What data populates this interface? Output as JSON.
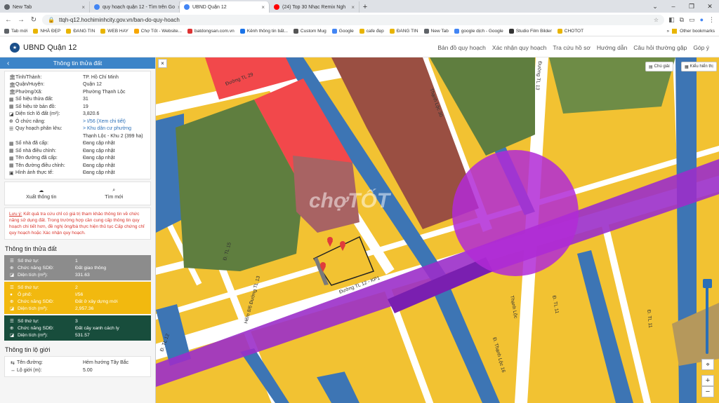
{
  "browser": {
    "tabs": [
      {
        "title": "New Tab",
        "color": "#5f6368",
        "active": false
      },
      {
        "title": "quy hoạch quận 12 - Tìm trên Go",
        "color": "#4285f4",
        "active": false
      },
      {
        "title": "UBND Quận 12",
        "color": "#4285f4",
        "active": true
      },
      {
        "title": "(24) Top 30 Nhạc Remix Ngh",
        "color": "#ff0000",
        "active": false
      }
    ],
    "url": "ttqh-q12.hochiminhcity.gov.vn/ban-do-quy-hoach",
    "bookmarks": [
      {
        "label": "Tab mới",
        "color": "#5f6368"
      },
      {
        "label": "NHÀ ĐẸP",
        "color": "#e8b400"
      },
      {
        "label": "ĐANG TIN",
        "color": "#e8b400"
      },
      {
        "label": "WEB HAY",
        "color": "#e8b400"
      },
      {
        "label": "Chợ Tốt - Website...",
        "color": "#f7a600"
      },
      {
        "label": "batdongsan.com.vn",
        "color": "#d33"
      },
      {
        "label": "Kênh thông tin bất...",
        "color": "#1a73e8"
      },
      {
        "label": "Custom Mug",
        "color": "#555"
      },
      {
        "label": "Google",
        "color": "#4285f4"
      },
      {
        "label": "cafe đẹp",
        "color": "#e8b400"
      },
      {
        "label": "ĐANG TIN",
        "color": "#e8b400"
      },
      {
        "label": "New Tab",
        "color": "#5f6368"
      },
      {
        "label": "google dịch - Google",
        "color": "#4285f4"
      },
      {
        "label": "Studio Film Bilder",
        "color": "#333"
      },
      {
        "label": "CHOTOT",
        "color": "#e8b400"
      }
    ],
    "other_bookmarks": "Other bookmarks"
  },
  "site": {
    "title": "UBND Quận 12",
    "nav": [
      "Bản đồ quy hoạch",
      "Xác nhận quy hoạch",
      "Tra cứu hồ sơ",
      "Hướng dẫn",
      "Câu hỏi thường gặp",
      "Góp ý"
    ]
  },
  "sidebar": {
    "header": "Thông tin thửa đất",
    "info": [
      {
        "label": "Tỉnh/Thành:",
        "value": "TP. Hồ Chí Minh"
      },
      {
        "label": "Quận/Huyện:",
        "value": "Quận 12"
      },
      {
        "label": "Phường/Xã:",
        "value": "Phường Thạnh Lộc"
      },
      {
        "label": "Số hiệu thửa đất:",
        "value": "31"
      },
      {
        "label": "Số hiệu tờ bản đồ:",
        "value": "19"
      },
      {
        "label": "Diện tích lô đất (m²):",
        "value": "3,820.6"
      },
      {
        "label": "Ô chức năng:",
        "value": "> I/56 (Xem chi tiết)"
      },
      {
        "label": "Quy hoạch phân khu:",
        "value": "> Khu dân cư phường"
      },
      {
        "label": "",
        "value": "Thạnh Lộc - Khu 2 (399 ha)"
      },
      {
        "label": "Số nhà đã cấp:",
        "value": "Đang cập nhật"
      },
      {
        "label": "Số nhà điều chỉnh:",
        "value": "Đang cập nhật"
      },
      {
        "label": "Tên đường đã cấp:",
        "value": "Đang cập nhật"
      },
      {
        "label": "Tên đường điều chỉnh:",
        "value": "Đang cập nhật"
      },
      {
        "label": "Hình ảnh thực tế:",
        "value": "Đang cập nhật"
      }
    ],
    "actions": {
      "export": "Xuất thông tin",
      "search": "Tìm mới"
    },
    "note_prefix": "Lưu ý:",
    "note": " Kết quả tra cứu chỉ có giá trị tham khảo thông tin về chức năng sử dụng đất. Trong trường hợp cần cung cấp thông tin quy hoạch chi tiết hơn, đề nghị ông/bà thực hiện thủ tục Cấp chứng chỉ quy hoạch hoặc Xác nhận quy hoạch.",
    "land_title": "Thông tin thửa đất",
    "land_blocks": [
      {
        "color": "gray",
        "rows": [
          {
            "label": "Số thứ tự:",
            "value": "1"
          },
          {
            "label": "Chức năng SDĐ:",
            "value": "Đất giao thông"
          },
          {
            "label": "Diện tích (m²):",
            "value": "331.63"
          }
        ]
      },
      {
        "color": "yellow",
        "rows": [
          {
            "label": "Số thứ tự:",
            "value": "2"
          },
          {
            "label": "Ô phố:",
            "value": "I/56"
          },
          {
            "label": "Chức năng SDĐ:",
            "value": "Đất ở xây dựng mới"
          },
          {
            "label": "Diện tích (m²):",
            "value": "2,957.36"
          }
        ]
      },
      {
        "color": "green",
        "rows": [
          {
            "label": "Số thứ tự:",
            "value": "3"
          },
          {
            "label": "Chức năng SDĐ:",
            "value": "Đất cây xanh cách ly"
          },
          {
            "label": "Diện tích (m²):",
            "value": "531.57"
          }
        ]
      }
    ],
    "road_title": "Thông tin lộ giới",
    "road": [
      {
        "label": "Tên đường:",
        "value": "Hẻm hướng Tây Bắc"
      },
      {
        "label": "Lộ giới (m):",
        "value": "5.00"
      }
    ]
  },
  "map": {
    "btn_notes": "Chú giải",
    "btn_display": "Kiểu hiển thị",
    "collapse": "×",
    "watermark": "chợTỐT",
    "zoom_in": "+",
    "zoom_out": "−",
    "labels": [
      "Đường TL 29",
      "Thạnh Lộc 30",
      "Đường TL 13",
      "Đường TL 12 - KP1",
      "Thạnh Lộc",
      "Đ. TL 11",
      "Đ. TL 15",
      "Hẻm 8/6 Đường TL 13",
      "Đ. TL 12",
      "Đ. Thạnh Lộc 16",
      "Đ. TL 11"
    ]
  }
}
